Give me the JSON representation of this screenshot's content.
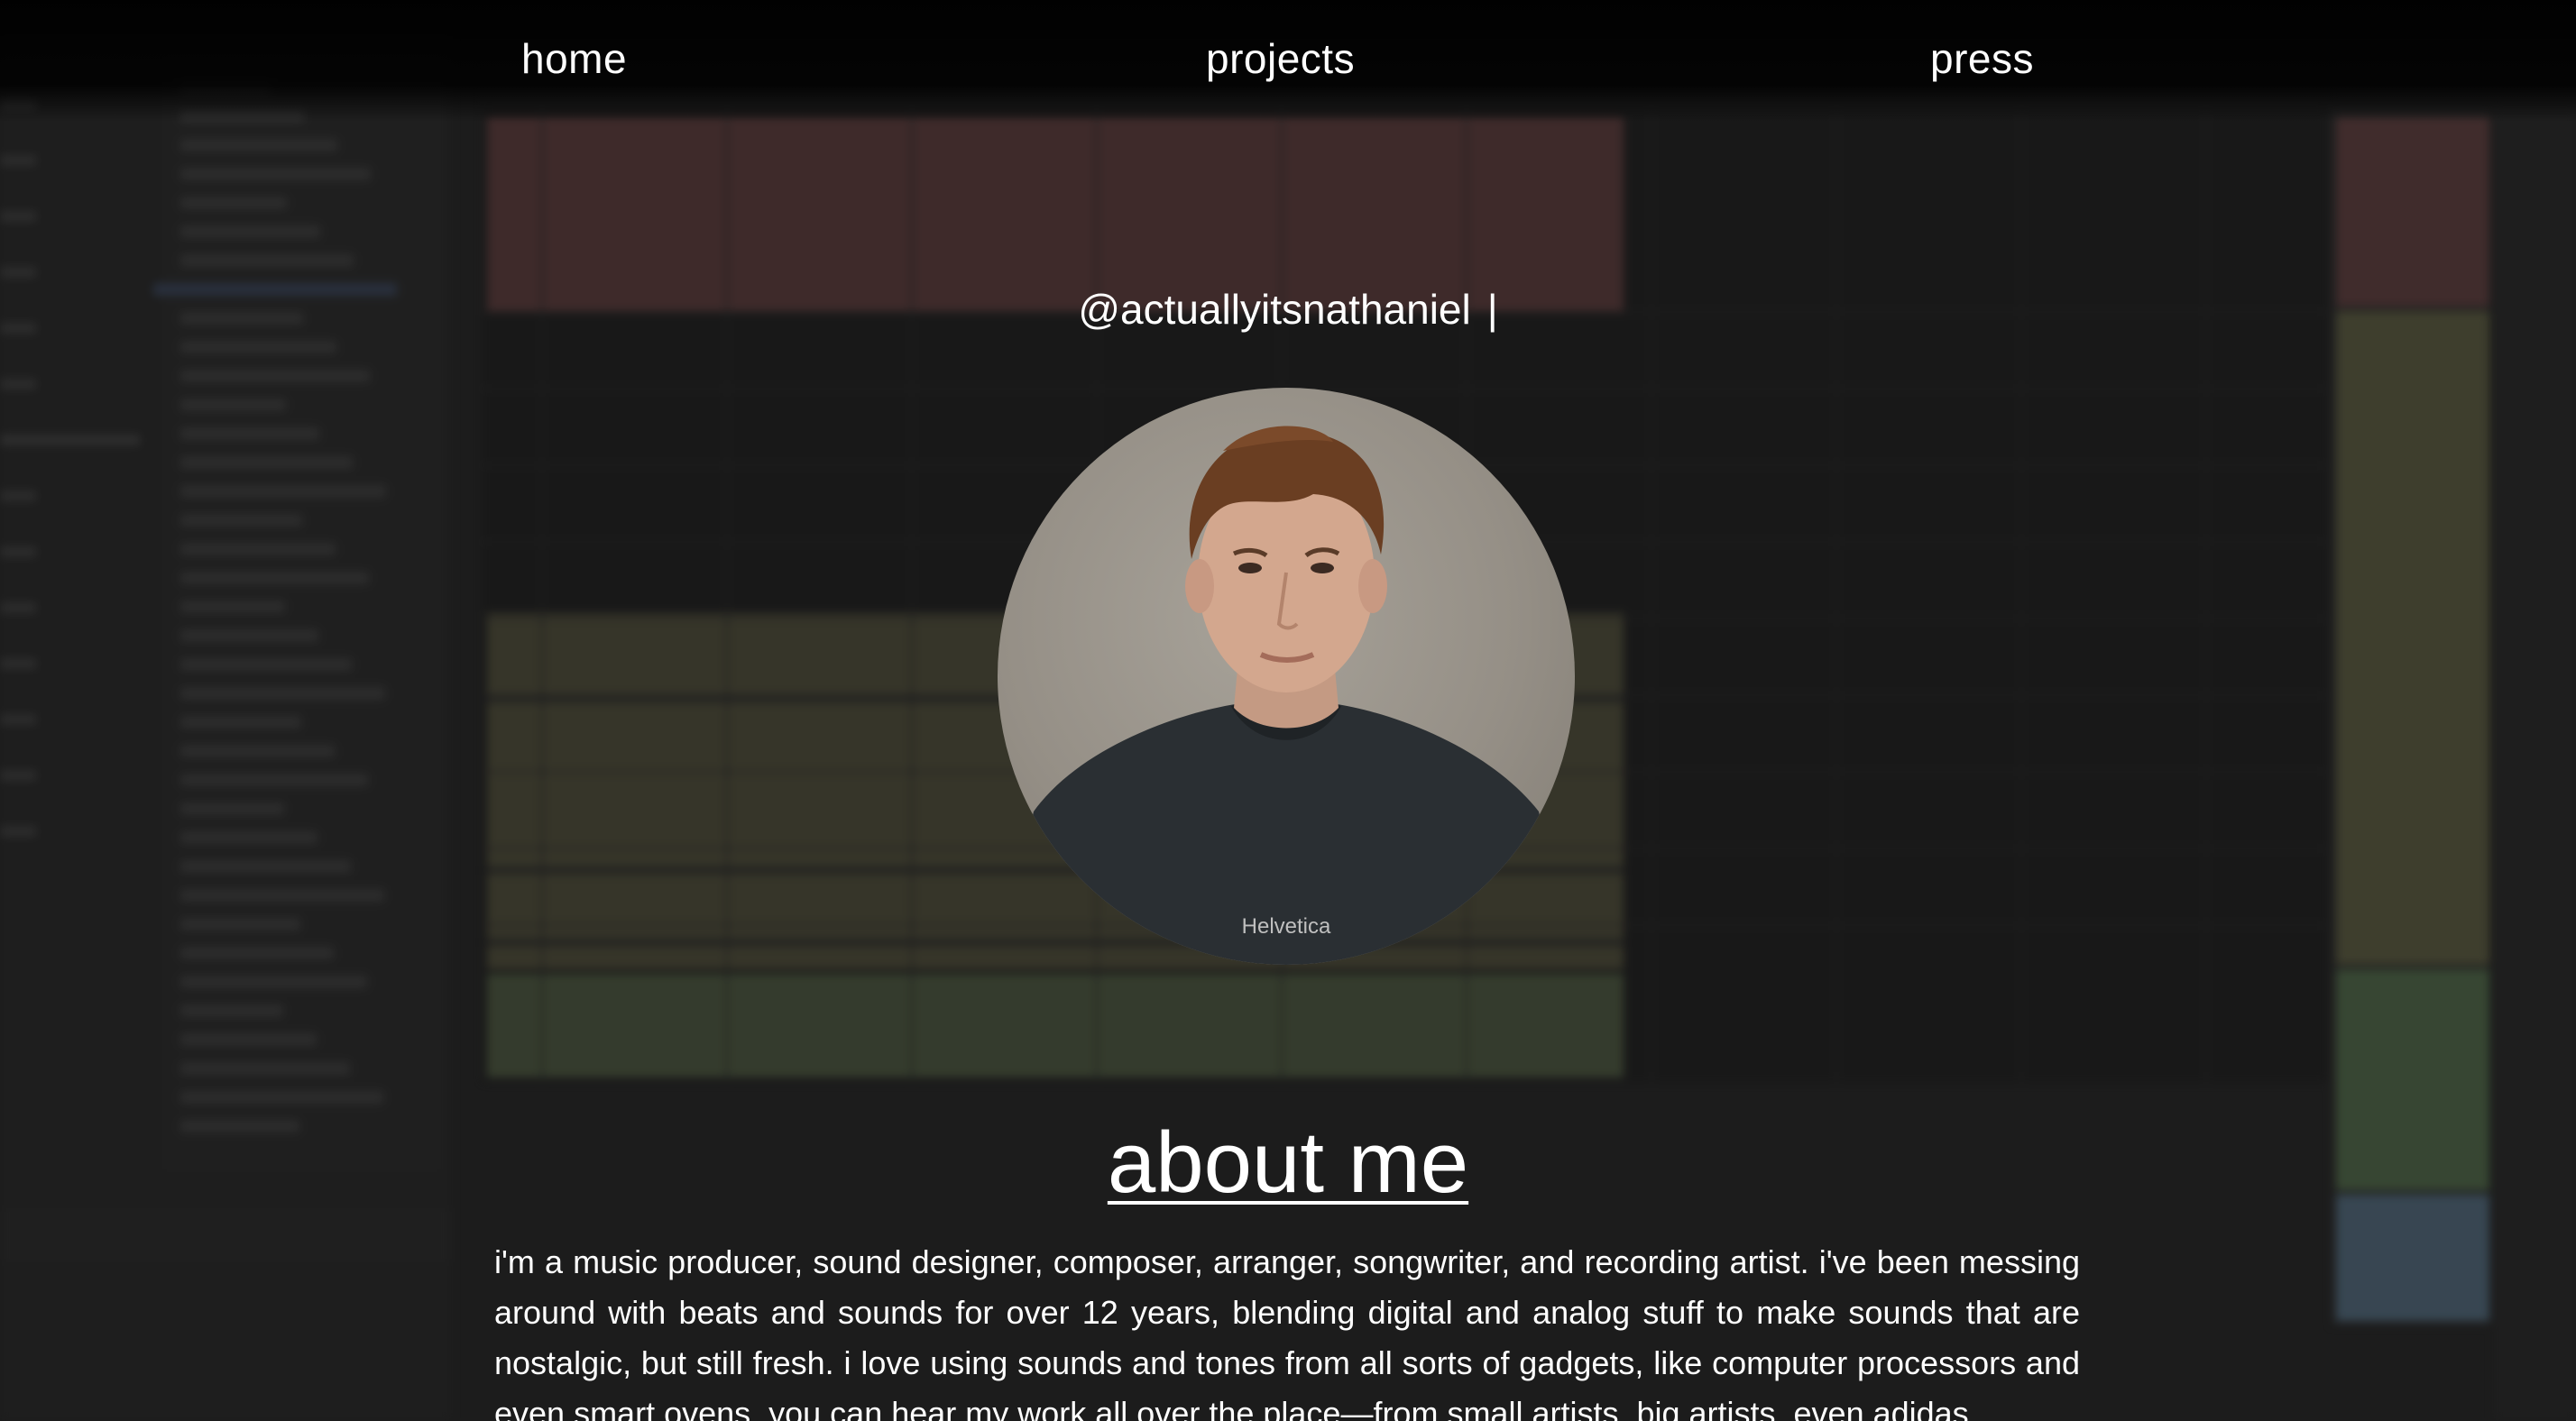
{
  "nav": {
    "home": "home",
    "projects": "projects",
    "press": "press"
  },
  "hero": {
    "handle": "@actuallyitsnathaniel",
    "cursor": "|",
    "avatar_shirt_text": "Helvetica"
  },
  "about": {
    "title": "about me",
    "body": "i'm a music producer, sound designer, composer, arranger, songwriter, and recording artist. i've been messing around with beats and sounds for over 12 years, blending digital and analog stuff to make sounds that are nostalgic, but still fresh. i love using sounds and tones from all sorts of gadgets, like computer processors and even smart ovens. you can hear my work all over the place—from small artists, big artists, even adidas"
  },
  "colors": {
    "background": "#1c1c1c",
    "text": "#ffffff",
    "nav_background": "#000000"
  }
}
